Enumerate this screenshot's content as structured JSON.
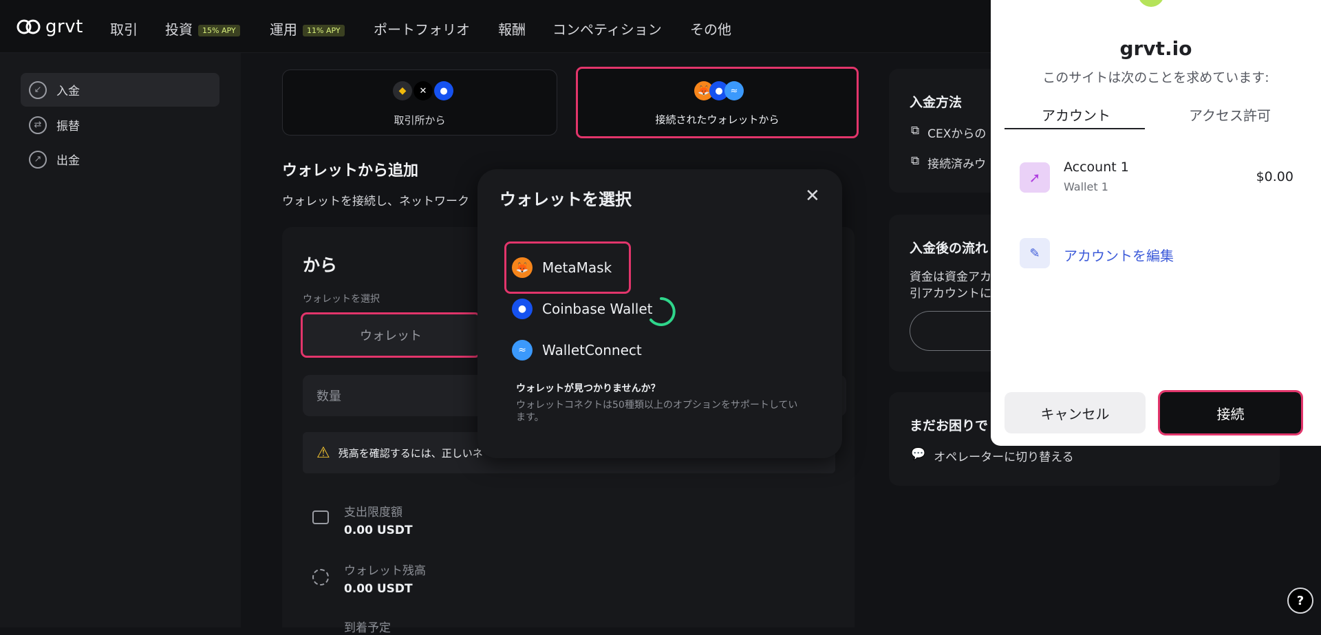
{
  "nav": {
    "logo": "grvt",
    "items": [
      {
        "label": "取引"
      },
      {
        "label": "投資",
        "badge": "15% APY"
      },
      {
        "label": "運用",
        "badge": "11% APY"
      },
      {
        "label": "ポートフォリオ"
      },
      {
        "label": "報酬"
      },
      {
        "label": "コンペティション"
      },
      {
        "label": "その他"
      }
    ]
  },
  "sidebar": {
    "items": [
      {
        "label": "入金",
        "icon": "arrow-down-left-icon"
      },
      {
        "label": "振替",
        "icon": "transfer-icon"
      },
      {
        "label": "出金",
        "icon": "arrow-up-right-icon"
      }
    ]
  },
  "deposit": {
    "source_exchange": "取引所から",
    "source_wallet": "接続されたウォレットから",
    "section_title": "ウォレットから追加",
    "section_desc": "ウォレットを接続し、ネットワーク",
    "from_title": "から",
    "wallet_label": "ウォレットを選択",
    "wallet_placeholder": "ウォレット",
    "amount_placeholder": "数量",
    "warning": "残高を確認するには、正しいネ",
    "spend_limit_label": "支出限度額",
    "spend_limit_value": "0.00 USDT",
    "wallet_balance_label": "ウォレット残高",
    "wallet_balance_value": "0.00 USDT",
    "arrival_label": "到着予定"
  },
  "right_panels": {
    "methods_title": "入金方法",
    "method_1": "CEXからの",
    "method_2": "接続済みウ",
    "flow_title": "入金後の流れ",
    "flow_desc_1": "資金は資金アカ",
    "flow_desc_2": "引アカウントに",
    "help_title": "まだお困りで",
    "help_operator": "オペレーターに切り替える"
  },
  "wallet_modal": {
    "title": "ウォレットを選択",
    "options": [
      {
        "label": "MetaMask",
        "icon": "metamask-icon"
      },
      {
        "label": "Coinbase Wallet",
        "icon": "coinbase-icon"
      },
      {
        "label": "WalletConnect",
        "icon": "walletconnect-icon"
      }
    ],
    "not_found_title": "ウォレットが見つかりませんか？",
    "not_found_desc": "ウォレットコネクトは50種類以上のオプションをサポートしています。"
  },
  "connect_popup": {
    "site": "grvt.io",
    "request": "このサイトは次のことを求めています:",
    "tab_account": "アカウント",
    "tab_permission": "アクセス許可",
    "account_name": "Account 1",
    "account_wallet": "Wallet 1",
    "account_balance": "$0.00",
    "edit_account": "アカウントを編集",
    "cancel": "キャンセル",
    "connect": "接続"
  },
  "help_button": "?"
}
